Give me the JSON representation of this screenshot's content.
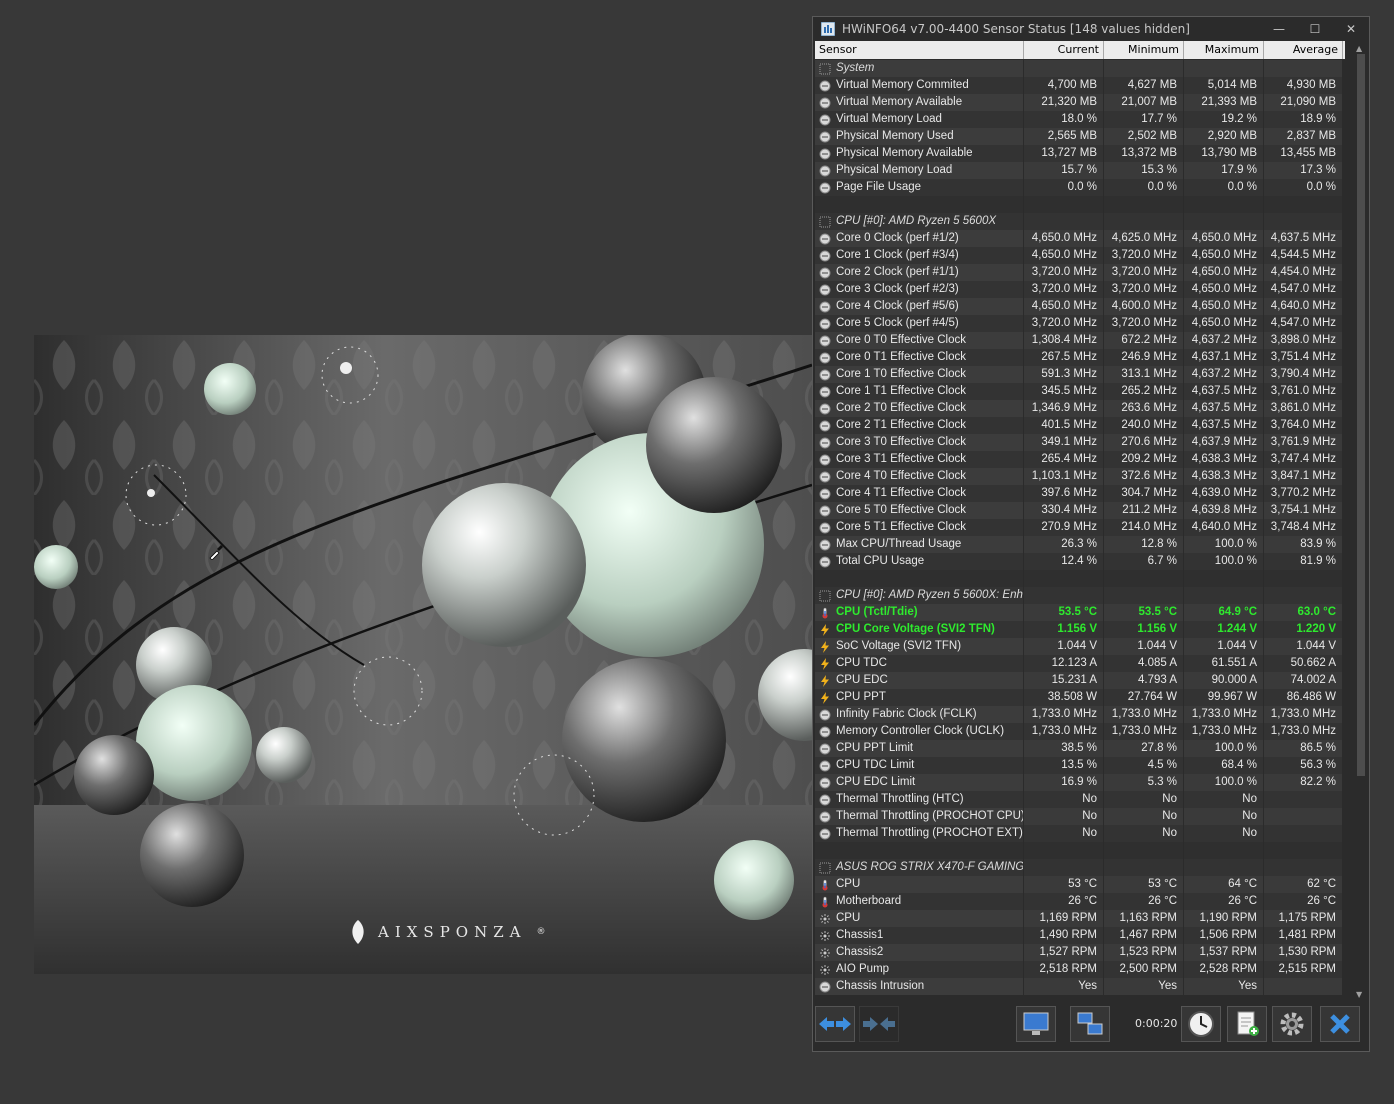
{
  "window": {
    "title": "HWiNFO64 v7.00-4400 Sensor Status [148 values hidden]",
    "minimize": "—",
    "maximize": "☐",
    "close": "✕"
  },
  "table": {
    "headers": [
      "Sensor",
      "Current",
      "Minimum",
      "Maximum",
      "Average"
    ]
  },
  "rows": [
    {
      "type": "group",
      "label": "System",
      "icon": "group-icon"
    },
    {
      "type": "data",
      "label": "Virtual Memory Commited",
      "icon": "sensor-icon",
      "cur": "4,700 MB",
      "min": "4,627 MB",
      "max": "5,014 MB",
      "avg": "4,930 MB"
    },
    {
      "type": "data",
      "label": "Virtual Memory Available",
      "icon": "sensor-icon",
      "cur": "21,320 MB",
      "min": "21,007 MB",
      "max": "21,393 MB",
      "avg": "21,090 MB"
    },
    {
      "type": "data",
      "label": "Virtual Memory Load",
      "icon": "sensor-icon",
      "cur": "18.0 %",
      "min": "17.7 %",
      "max": "19.2 %",
      "avg": "18.9 %"
    },
    {
      "type": "data",
      "label": "Physical Memory Used",
      "icon": "sensor-icon",
      "cur": "2,565 MB",
      "min": "2,502 MB",
      "max": "2,920 MB",
      "avg": "2,837 MB"
    },
    {
      "type": "data",
      "label": "Physical Memory Available",
      "icon": "sensor-icon",
      "cur": "13,727 MB",
      "min": "13,372 MB",
      "max": "13,790 MB",
      "avg": "13,455 MB"
    },
    {
      "type": "data",
      "label": "Physical Memory Load",
      "icon": "sensor-icon",
      "cur": "15.7 %",
      "min": "15.3 %",
      "max": "17.9 %",
      "avg": "17.3 %"
    },
    {
      "type": "data",
      "label": "Page File Usage",
      "icon": "sensor-icon",
      "cur": "0.0 %",
      "min": "0.0 %",
      "max": "0.0 %",
      "avg": "0.0 %"
    },
    {
      "type": "blank"
    },
    {
      "type": "group",
      "label": "CPU [#0]: AMD Ryzen 5 5600X",
      "icon": "group-icon"
    },
    {
      "type": "data",
      "label": "Core 0 Clock (perf #1/2)",
      "icon": "sensor-icon",
      "cur": "4,650.0 MHz",
      "min": "4,625.0 MHz",
      "max": "4,650.0 MHz",
      "avg": "4,637.5 MHz"
    },
    {
      "type": "data",
      "label": "Core 1 Clock (perf #3/4)",
      "icon": "sensor-icon",
      "cur": "4,650.0 MHz",
      "min": "3,720.0 MHz",
      "max": "4,650.0 MHz",
      "avg": "4,544.5 MHz"
    },
    {
      "type": "data",
      "label": "Core 2 Clock (perf #1/1)",
      "icon": "sensor-icon",
      "cur": "3,720.0 MHz",
      "min": "3,720.0 MHz",
      "max": "4,650.0 MHz",
      "avg": "4,454.0 MHz"
    },
    {
      "type": "data",
      "label": "Core 3 Clock (perf #2/3)",
      "icon": "sensor-icon",
      "cur": "3,720.0 MHz",
      "min": "3,720.0 MHz",
      "max": "4,650.0 MHz",
      "avg": "4,547.0 MHz"
    },
    {
      "type": "data",
      "label": "Core 4 Clock (perf #5/6)",
      "icon": "sensor-icon",
      "cur": "4,650.0 MHz",
      "min": "4,600.0 MHz",
      "max": "4,650.0 MHz",
      "avg": "4,640.0 MHz"
    },
    {
      "type": "data",
      "label": "Core 5 Clock (perf #4/5)",
      "icon": "sensor-icon",
      "cur": "3,720.0 MHz",
      "min": "3,720.0 MHz",
      "max": "4,650.0 MHz",
      "avg": "4,547.0 MHz"
    },
    {
      "type": "data",
      "label": "Core 0 T0 Effective Clock",
      "icon": "sensor-icon",
      "cur": "1,308.4 MHz",
      "min": "672.2 MHz",
      "max": "4,637.2 MHz",
      "avg": "3,898.0 MHz"
    },
    {
      "type": "data",
      "label": "Core 0 T1 Effective Clock",
      "icon": "sensor-icon",
      "cur": "267.5 MHz",
      "min": "246.9 MHz",
      "max": "4,637.1 MHz",
      "avg": "3,751.4 MHz"
    },
    {
      "type": "data",
      "label": "Core 1 T0 Effective Clock",
      "icon": "sensor-icon",
      "cur": "591.3 MHz",
      "min": "313.1 MHz",
      "max": "4,637.2 MHz",
      "avg": "3,790.4 MHz"
    },
    {
      "type": "data",
      "label": "Core 1 T1 Effective Clock",
      "icon": "sensor-icon",
      "cur": "345.5 MHz",
      "min": "265.2 MHz",
      "max": "4,637.5 MHz",
      "avg": "3,761.0 MHz"
    },
    {
      "type": "data",
      "label": "Core 2 T0 Effective Clock",
      "icon": "sensor-icon",
      "cur": "1,346.9 MHz",
      "min": "263.6 MHz",
      "max": "4,637.5 MHz",
      "avg": "3,861.0 MHz"
    },
    {
      "type": "data",
      "label": "Core 2 T1 Effective Clock",
      "icon": "sensor-icon",
      "cur": "401.5 MHz",
      "min": "240.0 MHz",
      "max": "4,637.5 MHz",
      "avg": "3,764.0 MHz"
    },
    {
      "type": "data",
      "label": "Core 3 T0 Effective Clock",
      "icon": "sensor-icon",
      "cur": "349.1 MHz",
      "min": "270.6 MHz",
      "max": "4,637.9 MHz",
      "avg": "3,761.9 MHz"
    },
    {
      "type": "data",
      "label": "Core 3 T1 Effective Clock",
      "icon": "sensor-icon",
      "cur": "265.4 MHz",
      "min": "209.2 MHz",
      "max": "4,638.3 MHz",
      "avg": "3,747.4 MHz"
    },
    {
      "type": "data",
      "label": "Core 4 T0 Effective Clock",
      "icon": "sensor-icon",
      "cur": "1,103.1 MHz",
      "min": "372.6 MHz",
      "max": "4,638.3 MHz",
      "avg": "3,847.1 MHz"
    },
    {
      "type": "data",
      "label": "Core 4 T1 Effective Clock",
      "icon": "sensor-icon",
      "cur": "397.6 MHz",
      "min": "304.7 MHz",
      "max": "4,639.0 MHz",
      "avg": "3,770.2 MHz"
    },
    {
      "type": "data",
      "label": "Core 5 T0 Effective Clock",
      "icon": "sensor-icon",
      "cur": "330.4 MHz",
      "min": "211.2 MHz",
      "max": "4,639.8 MHz",
      "avg": "3,754.1 MHz"
    },
    {
      "type": "data",
      "label": "Core 5 T1 Effective Clock",
      "icon": "sensor-icon",
      "cur": "270.9 MHz",
      "min": "214.0 MHz",
      "max": "4,640.0 MHz",
      "avg": "3,748.4 MHz"
    },
    {
      "type": "data",
      "label": "Max CPU/Thread Usage",
      "icon": "sensor-icon",
      "cur": "26.3 %",
      "min": "12.8 %",
      "max": "100.0 %",
      "avg": "83.9 %"
    },
    {
      "type": "data",
      "label": "Total CPU Usage",
      "icon": "sensor-icon",
      "cur": "12.4 %",
      "min": "6.7 %",
      "max": "100.0 %",
      "avg": "81.9 %"
    },
    {
      "type": "blank"
    },
    {
      "type": "group",
      "label": "CPU [#0]: AMD Ryzen 5 5600X: Enh...",
      "icon": "group-icon"
    },
    {
      "type": "data",
      "hl": true,
      "label": "CPU (Tctl/Tdie)",
      "icon": "thermometer-icon",
      "cur": "53.5 °C",
      "min": "53.5 °C",
      "max": "64.9 °C",
      "avg": "63.0 °C"
    },
    {
      "type": "data",
      "hl": true,
      "label": "CPU Core Voltage (SVI2 TFN)",
      "icon": "bolt-icon",
      "cur": "1.156 V",
      "min": "1.156 V",
      "max": "1.244 V",
      "avg": "1.220 V"
    },
    {
      "type": "data",
      "label": "SoC Voltage (SVI2 TFN)",
      "icon": "bolt-icon",
      "cur": "1.044 V",
      "min": "1.044 V",
      "max": "1.044 V",
      "avg": "1.044 V"
    },
    {
      "type": "data",
      "label": "CPU TDC",
      "icon": "bolt-icon",
      "cur": "12.123 A",
      "min": "4.085 A",
      "max": "61.551 A",
      "avg": "50.662 A"
    },
    {
      "type": "data",
      "label": "CPU EDC",
      "icon": "bolt-icon",
      "cur": "15.231 A",
      "min": "4.793 A",
      "max": "90.000 A",
      "avg": "74.002 A"
    },
    {
      "type": "data",
      "label": "CPU PPT",
      "icon": "bolt-icon",
      "cur": "38.508 W",
      "min": "27.764 W",
      "max": "99.967 W",
      "avg": "86.486 W"
    },
    {
      "type": "data",
      "label": "Infinity Fabric Clock (FCLK)",
      "icon": "sensor-icon",
      "cur": "1,733.0 MHz",
      "min": "1,733.0 MHz",
      "max": "1,733.0 MHz",
      "avg": "1,733.0 MHz"
    },
    {
      "type": "data",
      "label": "Memory Controller Clock (UCLK)",
      "icon": "sensor-icon",
      "cur": "1,733.0 MHz",
      "min": "1,733.0 MHz",
      "max": "1,733.0 MHz",
      "avg": "1,733.0 MHz"
    },
    {
      "type": "data",
      "label": "CPU PPT Limit",
      "icon": "sensor-icon",
      "cur": "38.5 %",
      "min": "27.8 %",
      "max": "100.0 %",
      "avg": "86.5 %"
    },
    {
      "type": "data",
      "label": "CPU TDC Limit",
      "icon": "sensor-icon",
      "cur": "13.5 %",
      "min": "4.5 %",
      "max": "68.4 %",
      "avg": "56.3 %"
    },
    {
      "type": "data",
      "label": "CPU EDC Limit",
      "icon": "sensor-icon",
      "cur": "16.9 %",
      "min": "5.3 %",
      "max": "100.0 %",
      "avg": "82.2 %"
    },
    {
      "type": "data",
      "label": "Thermal Throttling (HTC)",
      "icon": "sensor-icon",
      "cur": "No",
      "min": "No",
      "max": "No",
      "avg": ""
    },
    {
      "type": "data",
      "label": "Thermal Throttling (PROCHOT CPU)",
      "icon": "sensor-icon",
      "cur": "No",
      "min": "No",
      "max": "No",
      "avg": ""
    },
    {
      "type": "data",
      "label": "Thermal Throttling (PROCHOT EXT)",
      "icon": "sensor-icon",
      "cur": "No",
      "min": "No",
      "max": "No",
      "avg": ""
    },
    {
      "type": "blank"
    },
    {
      "type": "group",
      "label": "ASUS ROG STRIX X470-F GAMING (I...",
      "icon": "group-icon"
    },
    {
      "type": "data",
      "label": "CPU",
      "icon": "thermometer-icon",
      "cur": "53 °C",
      "min": "53 °C",
      "max": "64 °C",
      "avg": "62 °C"
    },
    {
      "type": "data",
      "label": "Motherboard",
      "icon": "thermometer-icon",
      "cur": "26 °C",
      "min": "26 °C",
      "max": "26 °C",
      "avg": "26 °C"
    },
    {
      "type": "data",
      "label": "CPU",
      "icon": "fan-icon",
      "cur": "1,169 RPM",
      "min": "1,163 RPM",
      "max": "1,190 RPM",
      "avg": "1,175 RPM"
    },
    {
      "type": "data",
      "label": "Chassis1",
      "icon": "fan-icon",
      "cur": "1,490 RPM",
      "min": "1,467 RPM",
      "max": "1,506 RPM",
      "avg": "1,481 RPM"
    },
    {
      "type": "data",
      "label": "Chassis2",
      "icon": "fan-icon",
      "cur": "1,527 RPM",
      "min": "1,523 RPM",
      "max": "1,537 RPM",
      "avg": "1,530 RPM"
    },
    {
      "type": "data",
      "label": "AIO Pump",
      "icon": "fan-icon",
      "cur": "2,518 RPM",
      "min": "2,500 RPM",
      "max": "2,528 RPM",
      "avg": "2,515 RPM"
    },
    {
      "type": "data",
      "label": "Chassis Intrusion",
      "icon": "sensor-icon",
      "cur": "Yes",
      "min": "Yes",
      "max": "Yes",
      "avg": ""
    }
  ],
  "toolbar": {
    "timer": "0:00:20"
  },
  "brand": {
    "name": "AIXSPONZA",
    "reg": "®"
  },
  "colors": {
    "highlight": "#2eea2e",
    "background": "#383838",
    "window": "#2b2b2b"
  }
}
